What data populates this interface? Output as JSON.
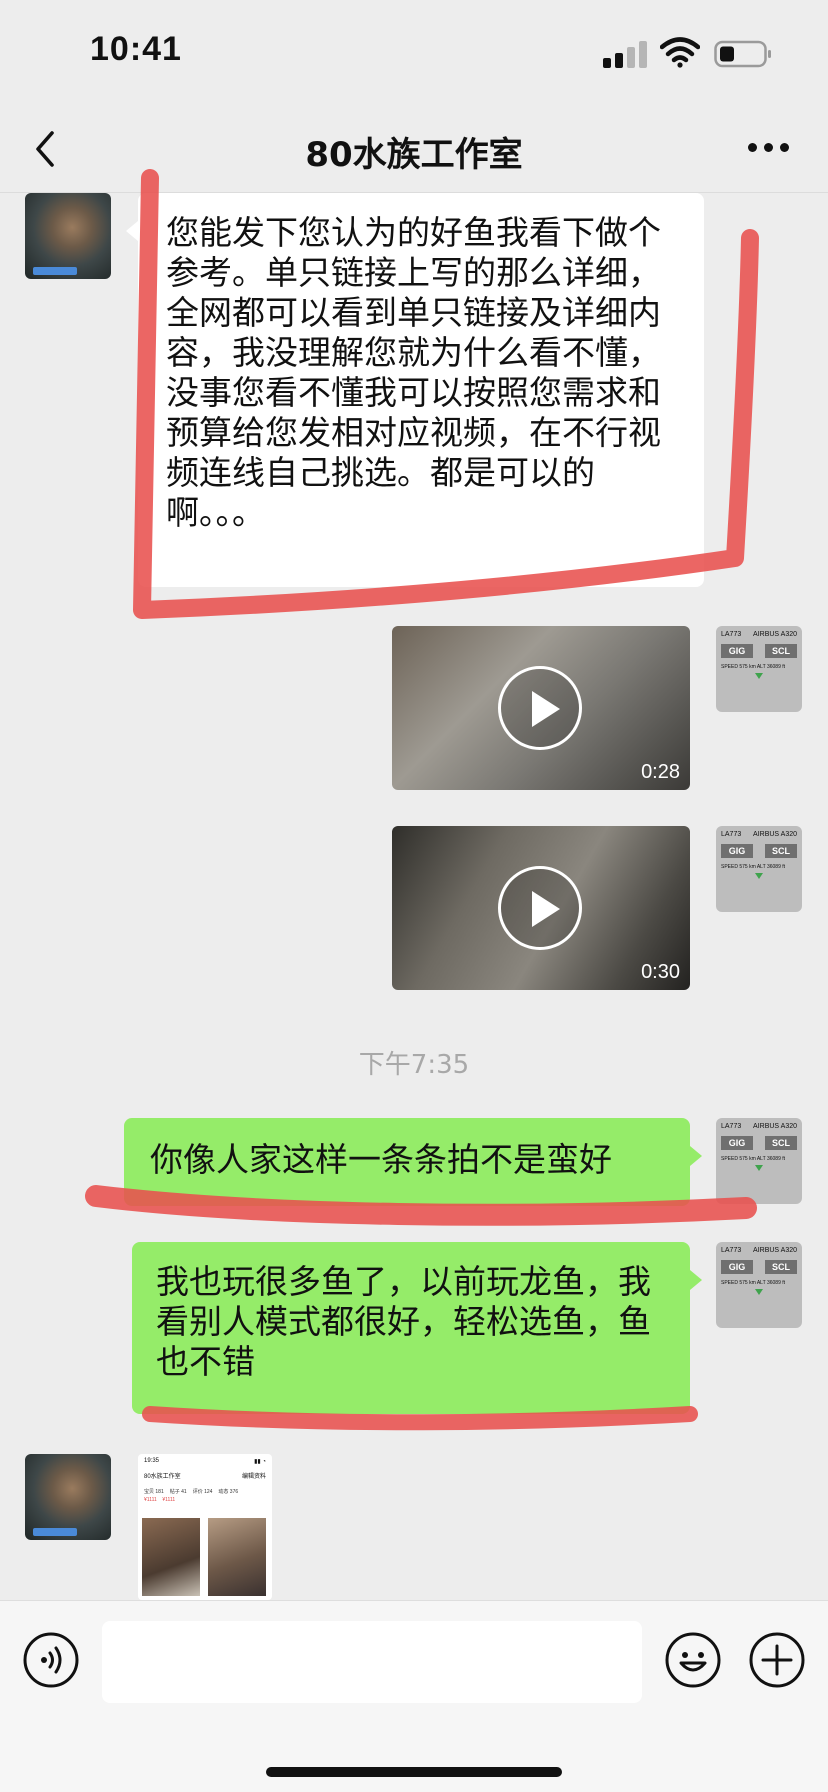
{
  "status_bar": {
    "time": "10:41"
  },
  "nav": {
    "title": "80水族工作室"
  },
  "messages": {
    "incoming_1": {
      "text": "您能发下您认为的好鱼我看下做个参考。单只链接上写的那么详细，全网都可以看到单只链接及详细内容，我没理解您就为什么看不懂，没事您看不懂我可以按照您需求和预算给您发相对应视频，在不行视频连线自己挑选。都是可以的啊。。。"
    },
    "video_1": {
      "duration": "0:28"
    },
    "video_2": {
      "duration": "0:30"
    },
    "timestamp": "下午7:35",
    "outgoing_1": {
      "text": "你像人家这样一条条拍不是蛮好"
    },
    "outgoing_2": {
      "text": "我也玩很多鱼了，以前玩龙鱼，我看别人模式都很好，轻松选鱼，鱼也不错"
    },
    "screenshot": {
      "time": "19:35",
      "title": "80水族工作室",
      "follow": "编辑资料",
      "tabs": [
        "宝贝 181",
        "帖子 41",
        "评价 124",
        "动态 376"
      ],
      "prices": [
        "¥1111",
        "¥1111"
      ]
    }
  },
  "self_avatar": {
    "flight": "LA773",
    "aircraft": "AIRBUS A320",
    "from": "GIG",
    "to": "SCL",
    "speed": "SPEED  575 km  ALT  36089 ft"
  },
  "annotation_color": "#e8514f",
  "incoming_bubble_color": "#ffffff",
  "outgoing_bubble_color": "#95ec69"
}
